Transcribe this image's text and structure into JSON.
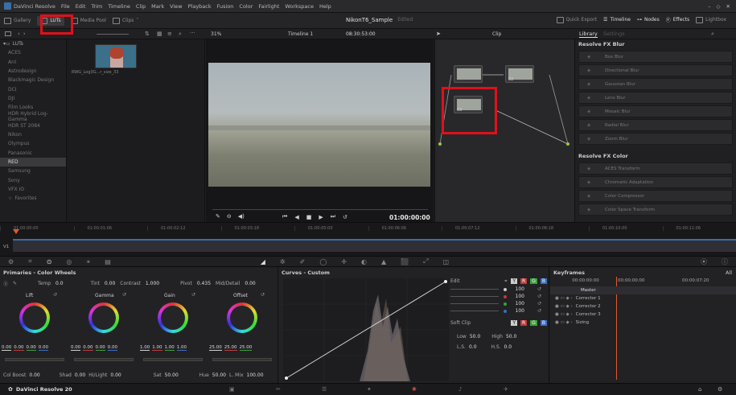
{
  "menubar": {
    "items": [
      "DaVinci Resolve",
      "File",
      "Edit",
      "Trim",
      "Timeline",
      "Clip",
      "Mark",
      "View",
      "Playback",
      "Fusion",
      "Color",
      "Fairlight",
      "Workspace",
      "Help"
    ]
  },
  "toolbar": {
    "gallery": "Gallery",
    "luts": "LUTs",
    "media_pool": "Media Pool",
    "clips": "Clips",
    "project_title": "NikonT6_Sample",
    "edited": "Edited",
    "quick_export": "Quick Export",
    "timeline": "Timeline",
    "nodes": "Nodes",
    "effects": "Effects",
    "lightbox": "Lightbox"
  },
  "subbar": {
    "zoom": "31%",
    "timeline_name": "Timeline 1",
    "timecode": "08:30:53:00",
    "clip": "Clip",
    "library_tab": "Library",
    "settings_tab": "Settings"
  },
  "lut_tree": {
    "root": "LUTs",
    "items": [
      "ACES",
      "Arri",
      "Astrodesign",
      "Blackmagic Design",
      "DCI",
      "DJI",
      "Film Looks",
      "HDR Hybrid Log-Gamma",
      "HDR ST 2084",
      "Nikon",
      "Olympus",
      "Panasonic",
      "RED",
      "Samsung",
      "Sony",
      "VFX IO",
      "Favorites"
    ],
    "selected": "RED"
  },
  "lut_thumb": {
    "label": "RWG_Log3G...r_size_33"
  },
  "viewer": {
    "timecode": "01:00:00:00"
  },
  "node_graph": {
    "node1": "01",
    "node2": "02",
    "node3": "03"
  },
  "library": {
    "section1": "Resolve FX Blur",
    "blur_items": [
      "Box Blur",
      "Directional Blur",
      "Gaussian Blur",
      "Lens Blur",
      "Mosaic Blur",
      "Radial Blur",
      "Zoom Blur"
    ],
    "section2": "Resolve FX Color",
    "color_items": [
      "ACES Transform",
      "Chromatic Adaptation",
      "Color Compressor",
      "Color Space Transform"
    ]
  },
  "timeline": {
    "ruler": [
      "01:00:00:00",
      "01:00:01:06",
      "01:00:02:12",
      "01:00:03:18",
      "01:00:05:00",
      "01:00:06:06",
      "01:00:07:12",
      "01:00:08:18",
      "01:00:10:00",
      "01:00:11:06"
    ],
    "track": "V1"
  },
  "primaries": {
    "title": "Primaries - Color Wheels",
    "temp_label": "Temp",
    "temp": "0.0",
    "tint_label": "Tint",
    "tint": "0.00",
    "contrast_label": "Contrast",
    "contrast": "1.000",
    "pivot_label": "Pivot",
    "pivot": "0.435",
    "middetail_label": "Mid/Detail",
    "middetail": "0.00",
    "wheels": [
      {
        "name": "Lift",
        "values": [
          "0.00",
          "0.00",
          "0.00",
          "0.00"
        ]
      },
      {
        "name": "Gamma",
        "values": [
          "0.00",
          "0.00",
          "0.00",
          "0.00"
        ]
      },
      {
        "name": "Gain",
        "values": [
          "1.00",
          "1.00",
          "1.00",
          "1.00"
        ]
      },
      {
        "name": "Offset",
        "values": [
          "25.00",
          "25.00",
          "25.00"
        ]
      }
    ],
    "colboost_label": "Col Boost",
    "colboost": "0.00",
    "shad_label": "Shad",
    "shad": "0.00",
    "hilight_label": "Hi/Light",
    "hilight": "0.00",
    "sat_label": "Sat",
    "sat": "50.00",
    "hue_label": "Hue",
    "hue": "50.00",
    "lmix_label": "L. Mix",
    "lmix": "100.00"
  },
  "curves": {
    "title": "Curves - Custom",
    "edit_label": "Edit",
    "channel_values": [
      "100",
      "100",
      "100",
      "100"
    ],
    "softclip_label": "Soft Clip",
    "low_label": "Low",
    "low": "50.0",
    "high_label": "High",
    "high": "50.0",
    "ls_label": "L.S.",
    "ls": "0.0",
    "hs_label": "H.S.",
    "hs": "0.0"
  },
  "keyframes": {
    "title": "Keyframes",
    "all": "All",
    "tc_left": "00:00:00:00",
    "tc_mid": "00:00:00:00",
    "tc_right": "00:00:07:20",
    "rows": [
      "Master",
      "Corrector 1",
      "Corrector 2",
      "Corrector 3",
      "Sizing"
    ]
  },
  "bottom": {
    "app_name": "DaVinci Resolve 20"
  },
  "colors": {
    "highlight": "#e0101a",
    "accent_red": "#e64b3c",
    "playhead": "#e05a2a"
  }
}
